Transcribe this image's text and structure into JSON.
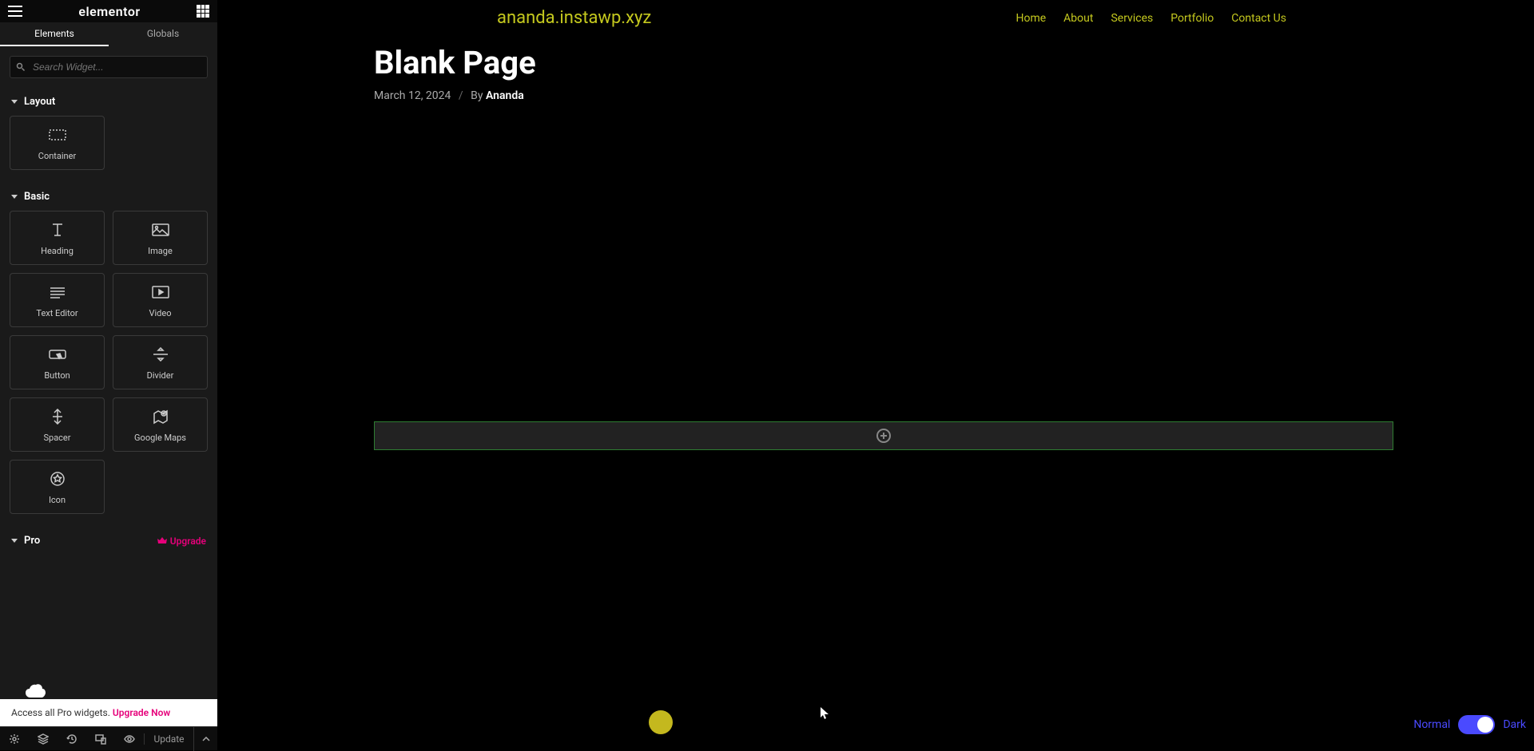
{
  "sidebar": {
    "logo": "elementor",
    "tabs": {
      "elements": "Elements",
      "globals": "Globals"
    },
    "search_placeholder": "Search Widget...",
    "categories": {
      "layout": {
        "label": "Layout",
        "widgets": [
          {
            "name": "container",
            "label": "Container"
          }
        ]
      },
      "basic": {
        "label": "Basic",
        "widgets": [
          {
            "name": "heading",
            "label": "Heading"
          },
          {
            "name": "image",
            "label": "Image"
          },
          {
            "name": "text-editor",
            "label": "Text Editor"
          },
          {
            "name": "video",
            "label": "Video"
          },
          {
            "name": "button",
            "label": "Button"
          },
          {
            "name": "divider",
            "label": "Divider"
          },
          {
            "name": "spacer",
            "label": "Spacer"
          },
          {
            "name": "google-maps",
            "label": "Google Maps"
          },
          {
            "name": "icon",
            "label": "Icon"
          }
        ]
      },
      "pro": {
        "label": "Pro"
      }
    },
    "upgrade_label": "Upgrade",
    "pro_banner": {
      "text": "Access all Pro widgets. ",
      "cta": "Upgrade Now"
    },
    "bottom": {
      "update": "Update"
    }
  },
  "canvas": {
    "site_title": "ananda.instawp.xyz",
    "nav": [
      "Home",
      "About",
      "Services",
      "Portfolio",
      "Contact Us"
    ],
    "page_title": "Blank Page",
    "date": "March 12, 2024",
    "by": "By ",
    "author": "Ananda"
  },
  "mode": {
    "normal": "Normal",
    "dark": "Dark"
  }
}
